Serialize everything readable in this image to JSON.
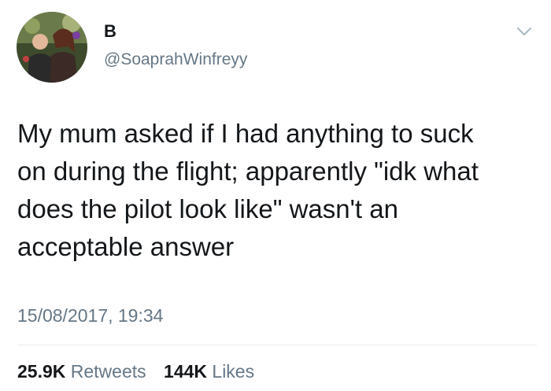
{
  "user": {
    "display_name": "B",
    "handle": "@SoaprahWinfreyy",
    "avatar_icon": "profile-photo"
  },
  "tweet": {
    "text": "My mum asked if I had anything to suck\non during the flight; apparently \"idk what\ndoes the pilot look like\" wasn't an\nacceptable answer",
    "timestamp": "15/08/2017, 19:34"
  },
  "stats": {
    "retweets_count": "25.9K",
    "retweets_label": "Retweets",
    "likes_count": "144K",
    "likes_label": "Likes"
  },
  "menu_icon": "chevron-down-icon",
  "colors": {
    "text": "#14171a",
    "secondary": "#657786",
    "divider": "#e6ecf0"
  }
}
